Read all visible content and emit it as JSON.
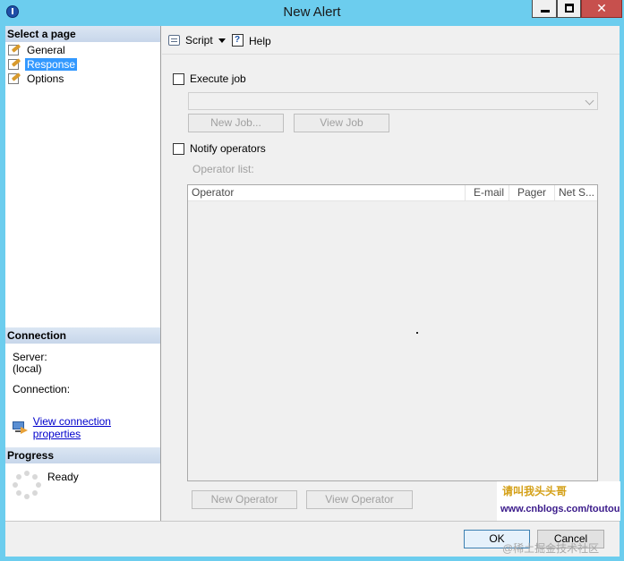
{
  "window": {
    "title": "New Alert"
  },
  "left_panel": {
    "select_page_header": "Select a page",
    "pages": [
      {
        "label": "General",
        "selected": false
      },
      {
        "label": "Response",
        "selected": true
      },
      {
        "label": "Options",
        "selected": false
      }
    ],
    "connection": {
      "header": "Connection",
      "server_label": "Server:",
      "server_value": "(local)",
      "connection_label": "Connection:",
      "view_properties_link": "View connection properties"
    },
    "progress": {
      "header": "Progress",
      "status": "Ready"
    }
  },
  "toolbar": {
    "script_label": "Script",
    "help_label": "Help"
  },
  "response": {
    "execute_job_label": "Execute job",
    "execute_job_checked": false,
    "job_combo_value": "",
    "new_job_button": "New Job...",
    "view_job_button": "View Job",
    "notify_operators_label": "Notify operators",
    "notify_operators_checked": false,
    "operator_list_label": "Operator list:",
    "operator_columns": [
      "Operator",
      "E-mail",
      "Pager",
      "Net S..."
    ],
    "operator_rows": [],
    "new_operator_button": "New Operator",
    "view_operator_button": "View Operator"
  },
  "footer": {
    "ok_button": "OK",
    "cancel_button": "Cancel"
  },
  "watermarks": {
    "line1": "请叫我头头哥",
    "line2": "www.cnblogs.com/toutou",
    "line3": "@稀土掘金技术社区"
  },
  "colors": {
    "title_bar": "#6ccdee",
    "close_button": "#c7504d",
    "selection": "#3399ff",
    "link": "#0000cc"
  }
}
